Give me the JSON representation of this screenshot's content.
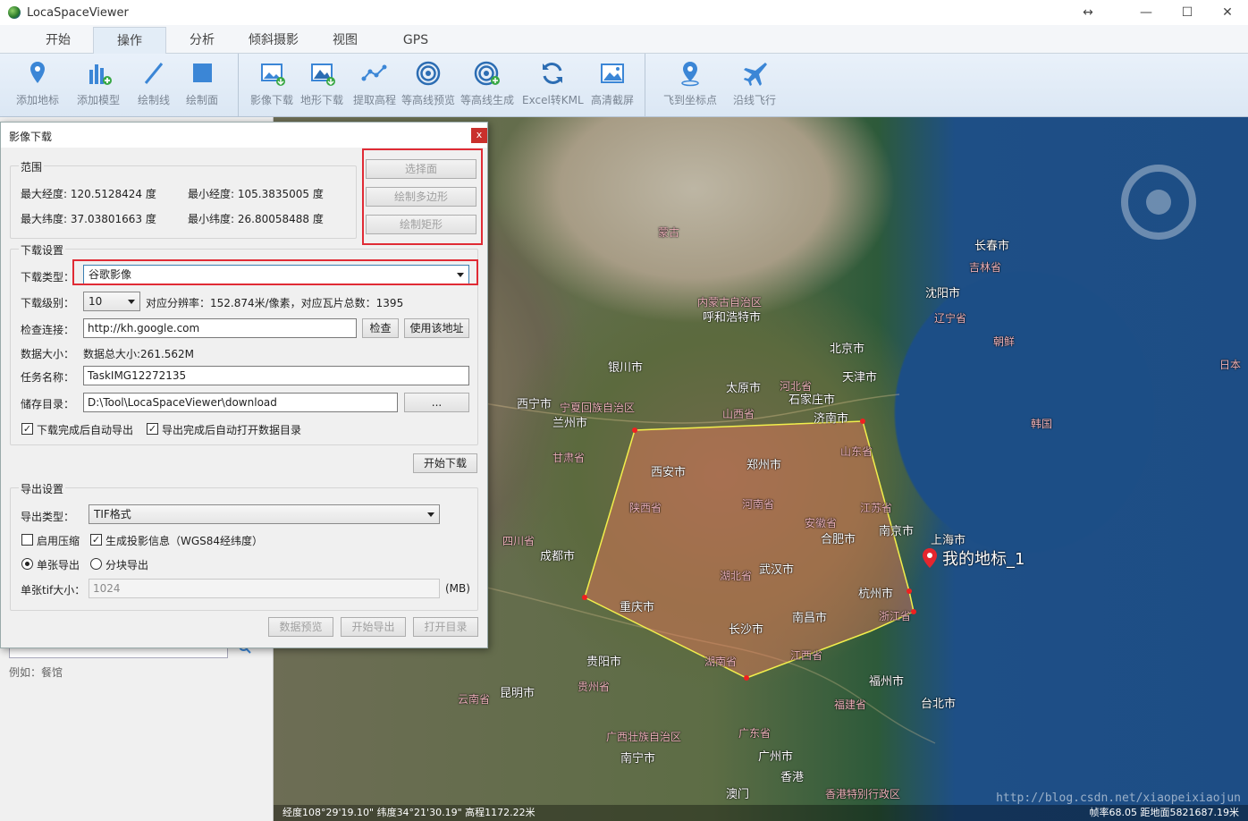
{
  "window": {
    "title": "LocaSpaceViewer",
    "controls": {
      "resize": "↔",
      "minimize": "—",
      "maximize": "☐",
      "close": "✕"
    }
  },
  "tabs": [
    "开始",
    "操作",
    "分析",
    "倾斜摄影",
    "视图",
    "GPS"
  ],
  "active_tab": "操作",
  "ribbon": {
    "group1": [
      "添加地标",
      "添加模型",
      "绘制线",
      "绘制面"
    ],
    "group2": [
      "影像下载",
      "地形下载",
      "提取高程",
      "等高线预览",
      "等高线生成",
      "Excel转KML",
      "高清截屏"
    ],
    "group3": [
      "飞到坐标点",
      "沿线飞行"
    ]
  },
  "left_panel": {
    "example": "例如：餐馆"
  },
  "dialog": {
    "title": "影像下载",
    "close": "x",
    "range": {
      "legend": "范围",
      "max_lon": "最大经度: 120.5128424 度",
      "min_lon": "最小经度: 105.3835005 度",
      "max_lat": "最大纬度: 37.03801663 度",
      "min_lat": "最小纬度: 26.80058488 度",
      "buttons": [
        "选择面",
        "绘制多边形",
        "绘制矩形"
      ]
    },
    "download": {
      "legend": "下载设置",
      "type_label": "下载类型：",
      "type_value": "谷歌影像",
      "level_label": "下载级别：",
      "level_value": "10",
      "resolution": "对应分辨率：152.874米/像素，对应瓦片总数：1395",
      "check_label": "检查连接：",
      "url": "http://kh.google.com",
      "check_btn": "检查",
      "use_btn": "使用该地址",
      "size_label": "数据大小：",
      "size_value": "数据总大小:261.562M",
      "task_label": "任务名称：",
      "task_value": "TaskIMG12272135",
      "dir_label": "储存目录：",
      "dir_value": "D:\\Tool\\LocaSpaceViewer\\download",
      "browse_btn": "...",
      "auto_export": "下载完成后自动导出",
      "auto_open": "导出完成后自动打开数据目录",
      "start_btn": "开始下载"
    },
    "export": {
      "legend": "导出设置",
      "type_label": "导出类型：",
      "type_value": "TIF格式",
      "compress": "启用压缩",
      "projection": "生成投影信息（WGS84经纬度）",
      "single": "单张导出",
      "tiled": "分块导出",
      "tif_label": "单张tif大小：",
      "tif_value": "1024",
      "tif_unit": "(MB)"
    },
    "footer": [
      "数据预览",
      "开始导出",
      "打开目录"
    ]
  },
  "map": {
    "marker_label": "我的地标_1",
    "status": "经度108°29'19.10\"  纬度34°21'30.19\"  高程1172.22米",
    "status_right": "帧率68.05  距地面5821687.19米",
    "watermark": "http://blog.csdn.net/xiaopeixiaojun",
    "cities": [
      "西安市",
      "郑州市",
      "武汉市",
      "重庆市",
      "长沙市",
      "南昌市",
      "合肥市",
      "南京市",
      "杭州市",
      "济南市",
      "太原市",
      "石家庄市",
      "北京市",
      "天津市",
      "上海市",
      "成都市",
      "贵阳市",
      "昆明市",
      "南宁市",
      "广州市",
      "香港",
      "澳门",
      "福州市",
      "台北市",
      "沈阳市",
      "长春市",
      "呼和浩特市",
      "银川市",
      "兰州市",
      "西宁市"
    ],
    "provinces": [
      "陕西省",
      "河南省",
      "湖北省",
      "安徽省",
      "江苏省",
      "山东省",
      "湖南省",
      "江西省",
      "浙江省",
      "四川省",
      "贵州省",
      "云南省",
      "广西壮族自治区",
      "广东省",
      "福建省",
      "河北省",
      "山西省",
      "宁夏回族自治区",
      "甘肃省",
      "内蒙古自治区",
      "吉林省",
      "辽宁省",
      "朝鲜",
      "韩国",
      "日本",
      "蒙古",
      "香港特别行政区"
    ]
  }
}
